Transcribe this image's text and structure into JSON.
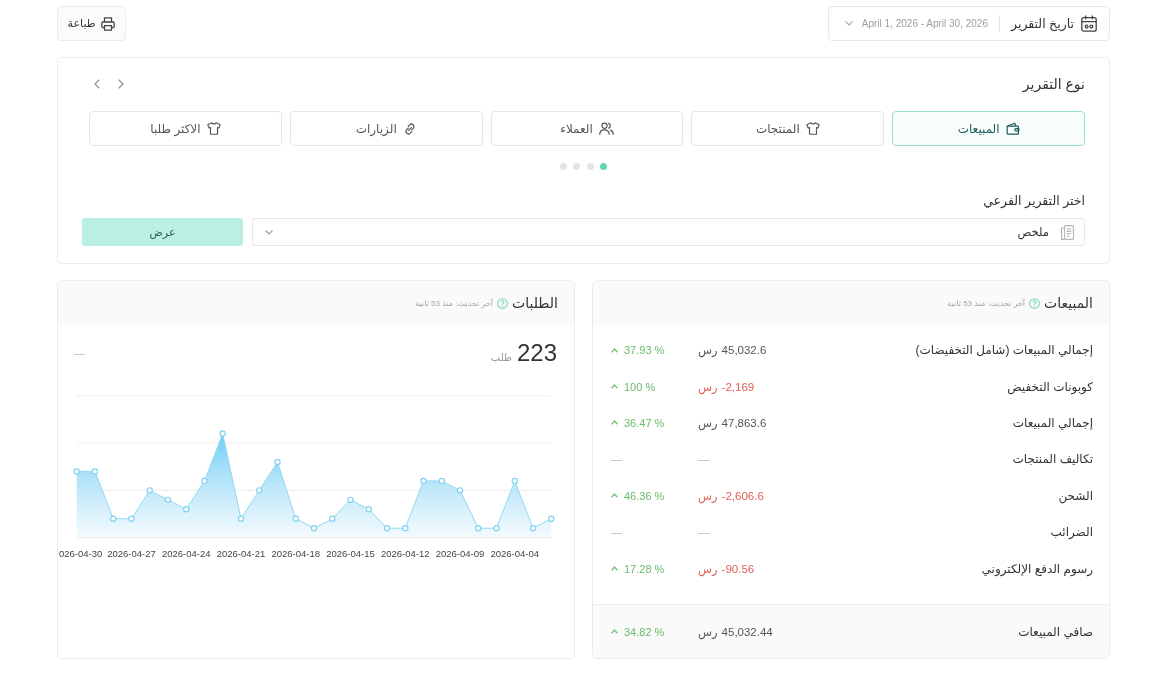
{
  "toolbar": {
    "date_filter": {
      "label": "تاريخ التقرير",
      "value": "April 1, 2026 - April 30, 2026"
    },
    "print_button": "طباعة"
  },
  "report_type": {
    "title": "نوع التقرير",
    "tabs": [
      {
        "label": "المبيعات",
        "selected": true
      },
      {
        "label": "المنتجات",
        "selected": false
      },
      {
        "label": "العملاء",
        "selected": false
      },
      {
        "label": "الزيارات",
        "selected": false
      },
      {
        "label": "الاكثر طلبا",
        "selected": false
      }
    ],
    "pages": [
      {
        "selected": true
      },
      {
        "selected": false
      },
      {
        "selected": false
      },
      {
        "selected": false
      }
    ],
    "subreport": {
      "label": "اختر التقرير الفرعي",
      "value": "ملخص",
      "button": "عرض"
    }
  },
  "sales": {
    "title": "المبيعات",
    "updated": "آخر تحديث: منذ 53 ثانية",
    "rows": [
      {
        "label": "إجمالي المبيعات (شامل التخفيضات)",
        "amount": "45,032.6",
        "currency": "رس",
        "negative": false,
        "change": "37.93 %",
        "rising": true
      },
      {
        "label": "كوبونات التخفيض",
        "amount": "-2,169",
        "currency": "رس",
        "negative": true,
        "change": "100 %",
        "rising": true
      },
      {
        "label": "إجمالي المبيعات",
        "amount": "47,863.6",
        "currency": "رس",
        "negative": false,
        "change": "36.47 %",
        "rising": true
      },
      {
        "label": "تكاليف المنتجات",
        "amount": "—",
        "change": "—"
      },
      {
        "label": "الشحن",
        "amount": "-2,606.6",
        "currency": "رس",
        "negative": true,
        "change": "46.36 %",
        "rising": true
      },
      {
        "label": "الضرائب",
        "amount": "—",
        "change": "—"
      },
      {
        "label": "رسوم الدفع الإلكتروني",
        "amount": "-90.56",
        "currency": "رس",
        "negative": true,
        "change": "17.28 %",
        "rising": true
      }
    ],
    "total": {
      "label": "صافي المبيعات",
      "amount": "45,032.44",
      "currency": "رس",
      "negative": false,
      "change": "34.82 %",
      "rising": true
    }
  },
  "orders": {
    "title": "الطلبات",
    "updated": "آخر تحديث: منذ 53 ثانية",
    "count": "223",
    "unit": "طلب",
    "change": "—",
    "trend_graph": {
      "x_labels": [
        "2026-04-04",
        "2026-04-09",
        "2026-04-12",
        "2026-04-15",
        "2026-04-18",
        "2026-04-21",
        "2026-04-24",
        "2026-04-27",
        "026-04-30"
      ]
    }
  }
}
